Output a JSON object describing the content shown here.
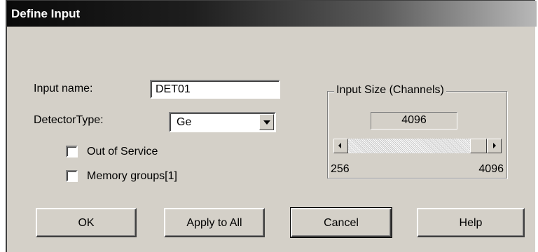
{
  "window": {
    "title": "Define Input"
  },
  "fields": {
    "input_name_label": "Input name:",
    "input_name_value": "DET01",
    "detector_type_label": "DetectorType:",
    "detector_type_value": "Ge"
  },
  "checkboxes": [
    {
      "label": "Out of Service",
      "checked": false
    },
    {
      "label": "Memory groups[1]",
      "checked": false
    }
  ],
  "input_size": {
    "title": "Input Size (Channels)",
    "value": "4096",
    "min_label": "256",
    "max_label": "4096",
    "slider_fraction": 1.0
  },
  "buttons": {
    "ok": "OK",
    "apply_all": "Apply to All",
    "cancel": "Cancel",
    "help": "Help"
  }
}
